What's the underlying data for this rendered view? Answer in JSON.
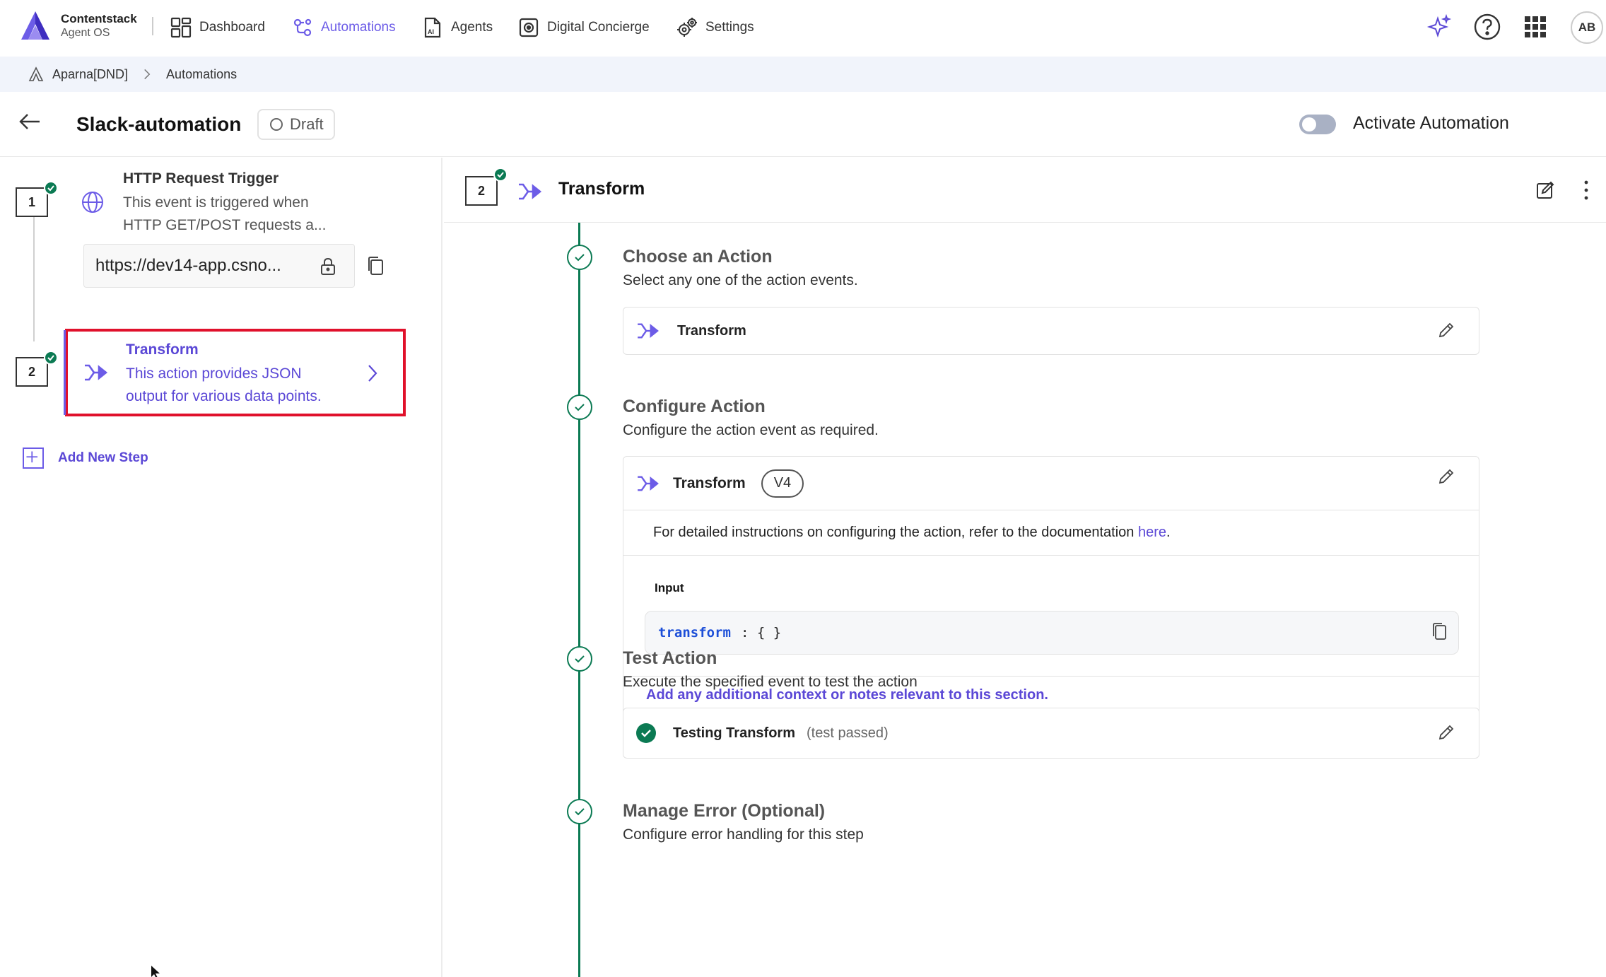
{
  "brand": {
    "name": "Contentstack",
    "product": "Agent OS"
  },
  "nav": {
    "items": [
      {
        "label": "Dashboard"
      },
      {
        "label": "Automations"
      },
      {
        "label": "Agents"
      },
      {
        "label": "Digital Concierge"
      },
      {
        "label": "Settings"
      }
    ],
    "avatar": "AB"
  },
  "breadcrumb": {
    "items": [
      "Aparna[DND]",
      "Automations"
    ]
  },
  "header": {
    "title": "Slack-automation",
    "status": "Draft",
    "activate_label": "Activate Automation"
  },
  "left": {
    "steps": [
      {
        "number": "1",
        "title": "HTTP Request Trigger",
        "desc_line1": "This event is triggered when",
        "desc_line2": "HTTP GET/POST requests a...",
        "url": "https://dev14-app.csno..."
      },
      {
        "number": "2",
        "title": "Transform",
        "desc_line1": "This action provides JSON",
        "desc_line2": "output for various data points."
      }
    ],
    "add_step_label": "Add New Step"
  },
  "main": {
    "step_number": "2",
    "title": "Transform",
    "sections": {
      "choose": {
        "title": "Choose an Action",
        "sub": "Select any one of the action events.",
        "action": "Transform"
      },
      "configure": {
        "title": "Configure Action",
        "sub": "Configure the action event as required.",
        "action": "Transform",
        "version": "V4",
        "doc_text": "For detailed instructions on configuring the action, refer to the documentation ",
        "doc_link": "here",
        "doc_end": ".",
        "input_label": "Input",
        "code_key": "transform",
        "code_rest": ": { }",
        "notes_link": "Add any additional context or notes relevant to this section."
      },
      "test": {
        "title": "Test Action",
        "sub": "Execute the specified event to test the action",
        "label": "Testing Transform",
        "status": "(test passed)"
      },
      "error": {
        "title": "Manage Error (Optional)",
        "sub": "Configure error handling for this step"
      }
    }
  },
  "colors": {
    "accent": "#6c5ce7",
    "success": "#0b7a53",
    "highlight": "#e0112b"
  }
}
